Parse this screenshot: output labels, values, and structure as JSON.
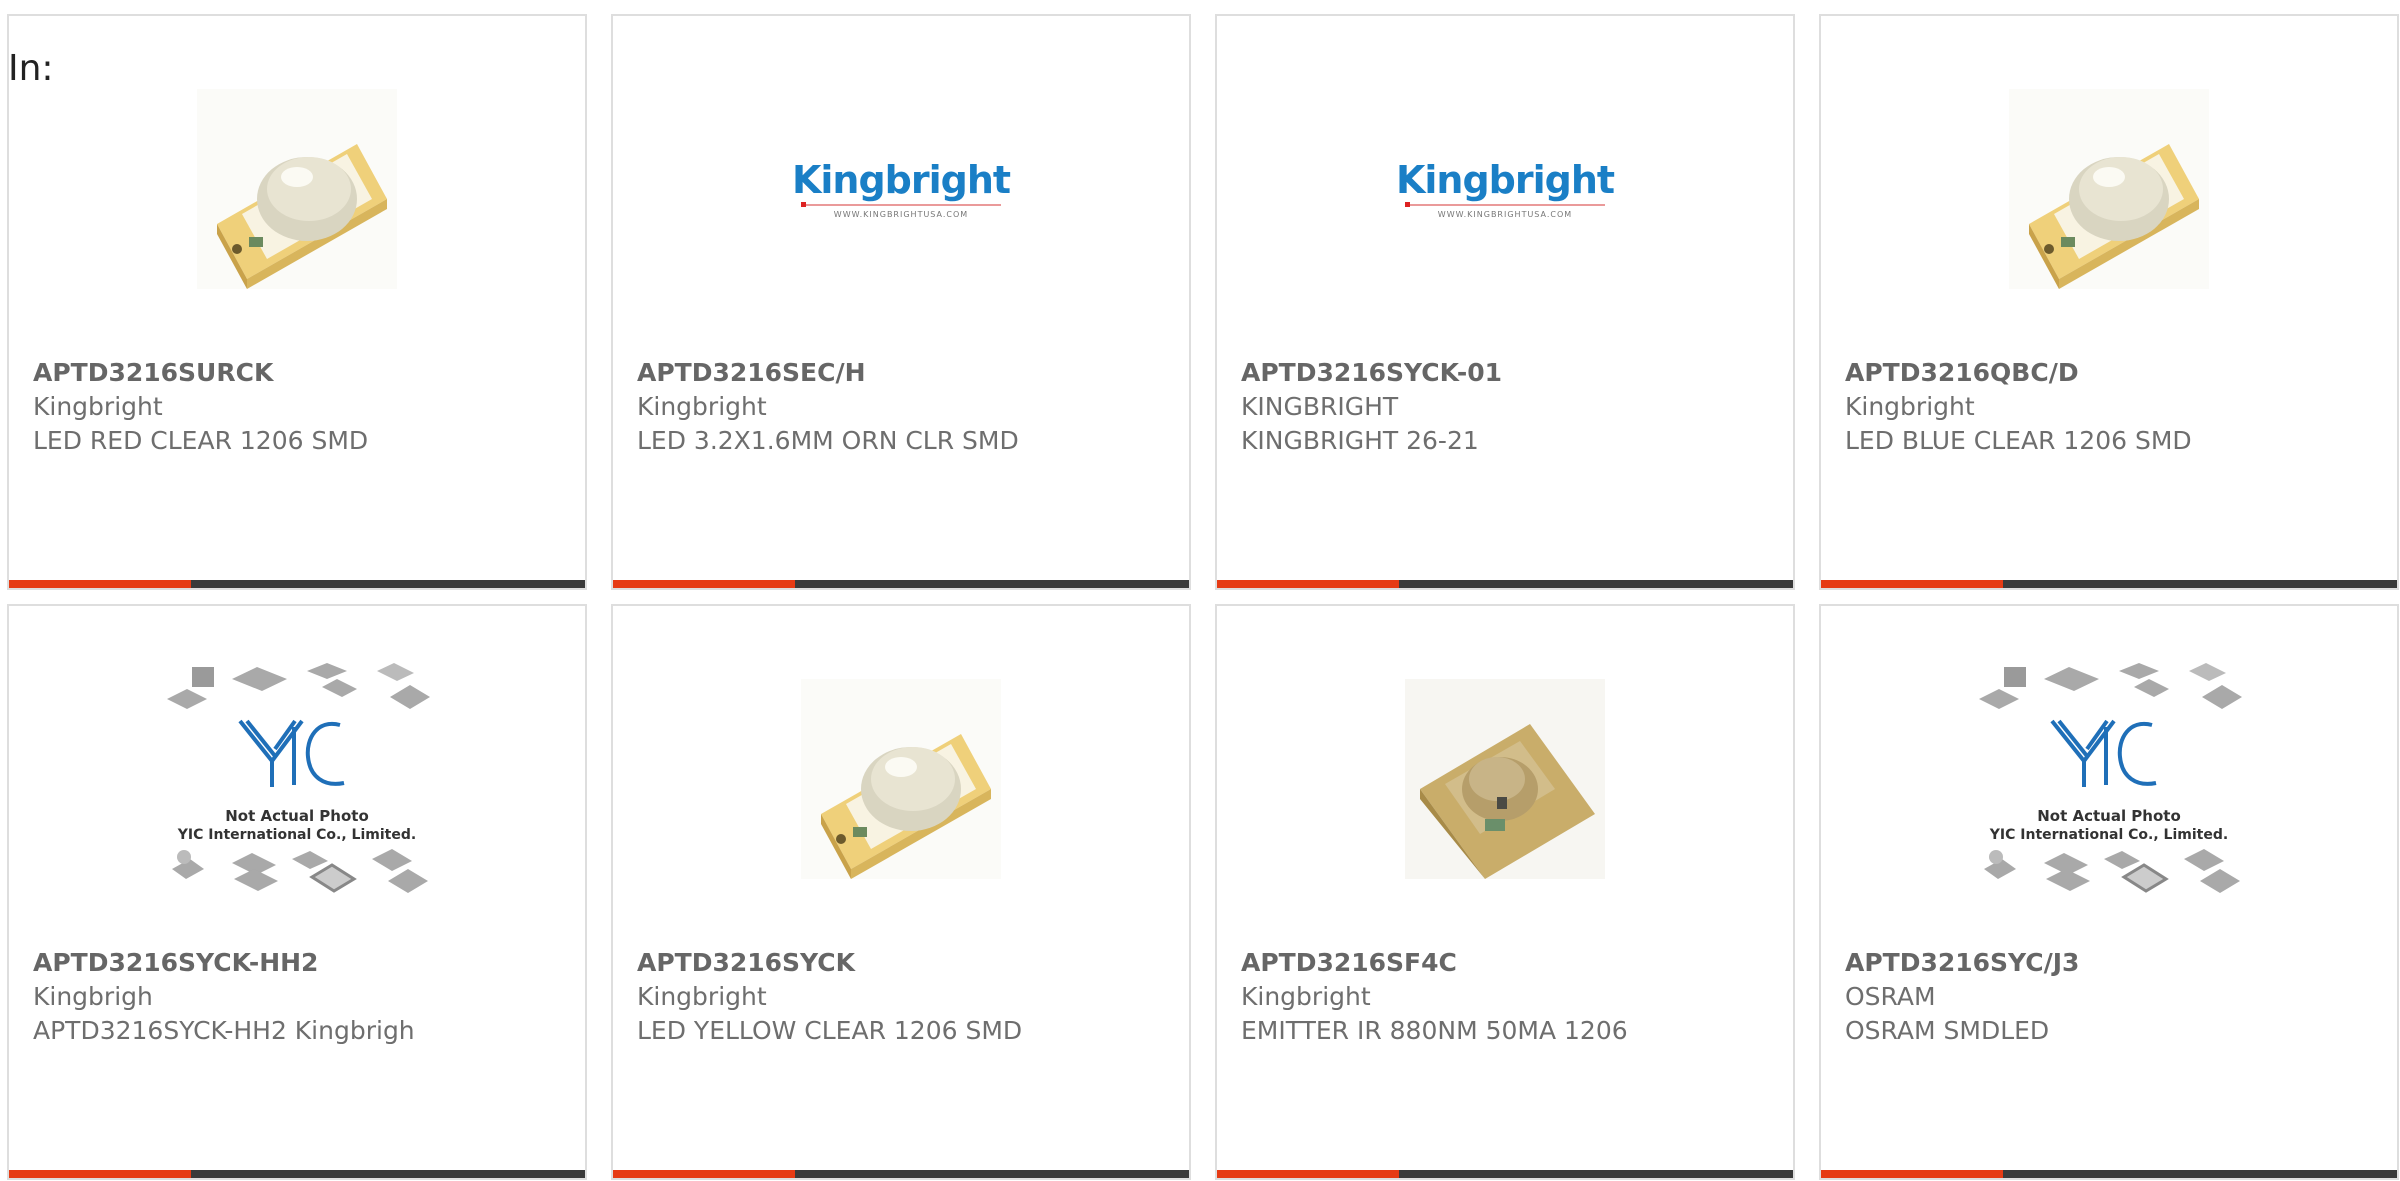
{
  "page": {
    "prefix_label": "In:"
  },
  "products": [
    {
      "part_number": "APTD3216SURCK",
      "manufacturer": "Kingbright",
      "description": "LED RED CLEAR 1206 SMD",
      "image": "led-smd-photo"
    },
    {
      "part_number": "APTD3216SEC/H",
      "manufacturer": "Kingbright",
      "description": "LED 3.2X1.6MM ORN CLR SMD",
      "image": "kingbright-logo",
      "logo_text": "Kingbright",
      "logo_url": "WWW.KINGBRIGHTUSA.COM"
    },
    {
      "part_number": "APTD3216SYCK-01",
      "manufacturer": "KINGBRIGHT",
      "description": "KINGBRIGHT 26-21",
      "image": "kingbright-logo",
      "logo_text": "Kingbright",
      "logo_url": "WWW.KINGBRIGHTUSA.COM"
    },
    {
      "part_number": "APTD3216QBC/D",
      "manufacturer": "Kingbright",
      "description": "LED BLUE CLEAR 1206 SMD",
      "image": "led-smd-photo"
    },
    {
      "part_number": "APTD3216SYCK-HH2",
      "manufacturer": "Kingbrigh",
      "description": "APTD3216SYCK-HH2 Kingbrigh",
      "image": "not-actual-photo-placeholder",
      "placeholder_line1": "Not Actual Photo",
      "placeholder_line2": "YIC International Co., Limited."
    },
    {
      "part_number": "APTD3216SYCK",
      "manufacturer": "Kingbright",
      "description": "LED YELLOW CLEAR 1206 SMD",
      "image": "led-smd-photo"
    },
    {
      "part_number": "APTD3216SF4C",
      "manufacturer": "Kingbright",
      "description": "EMITTER IR 880NM 50MA 1206",
      "image": "ir-emitter-photo"
    },
    {
      "part_number": "APTD3216SYC/J3",
      "manufacturer": "OSRAM",
      "description": "OSRAM SMDLED",
      "image": "not-actual-photo-placeholder",
      "placeholder_line1": "Not Actual Photo",
      "placeholder_line2": "YIC International Co., Limited."
    }
  ],
  "colors": {
    "accent_bar": "#e63b14",
    "dark_bar": "#3a3a3a",
    "brand_blue": "#1a7fc6",
    "text_gray": "#6e6e6e"
  }
}
